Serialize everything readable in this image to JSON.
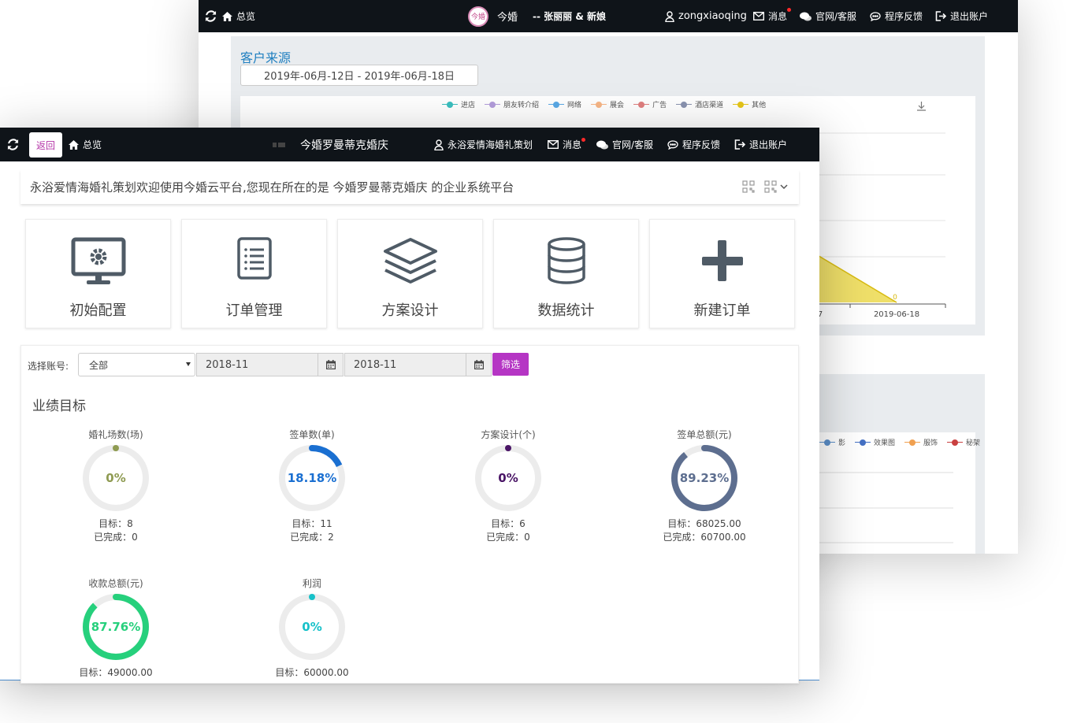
{
  "back_window": {
    "topbar": {
      "overview": "总览",
      "logo_text": "今婚",
      "brand": "今婚",
      "couple": "-- 张丽丽 & 新娘",
      "user": "zongxiaoqing",
      "messages": "消息",
      "site_service": "官网/客服",
      "feedback": "程序反馈",
      "logout": "退出账户"
    },
    "section_title": "客户来源",
    "date_range": "2019年-06月-12日 - 2019年-06月-18日",
    "legend": [
      "进店",
      "朋友转介绍",
      "网络",
      "展会",
      "广告",
      "酒店渠道",
      "其他"
    ],
    "legend_colors": [
      "#3bbfbf",
      "#b39ddb",
      "#5aa9e6",
      "#f7b686",
      "#e07f7f",
      "#8a93b0",
      "#e6c619"
    ],
    "chart_data": {
      "type": "area",
      "x_tick_labels": [
        "7",
        "2019-06-18"
      ],
      "point_label": "0"
    },
    "legend2": [
      "影",
      "效果图",
      "服饰",
      "秘架"
    ],
    "legend2_colors": [
      "#5b8fc9",
      "#4470c4",
      "#f0a050",
      "#c94040"
    ]
  },
  "front_window": {
    "topbar": {
      "back": "返回",
      "overview": "总览",
      "store_name": "今婚罗曼蒂克婚庆",
      "user": "永浴爱情海婚礼策划",
      "messages": "消息",
      "site_service": "官网/客服",
      "feedback": "程序反馈",
      "logout": "退出账户"
    },
    "welcome": "永浴爱情海婚礼策划欢迎使用今婚云平台,您现在所在的是 今婚罗曼蒂克婚庆 的企业系统平台",
    "tiles": [
      {
        "label": "初始配置",
        "icon": "monitor-gear-icon"
      },
      {
        "label": "订单管理",
        "icon": "list-document-icon"
      },
      {
        "label": "方案设计",
        "icon": "layers-icon"
      },
      {
        "label": "数据统计",
        "icon": "database-icon"
      },
      {
        "label": "新建订单",
        "icon": "plus-icon"
      }
    ],
    "filter": {
      "label": "选择账号:",
      "account": "全部",
      "start": "2018-11",
      "end": "2018-11",
      "button": "筛选"
    },
    "perf_title": "业绩目标",
    "gauges": [
      {
        "title": "婚礼场数(场)",
        "percent": "0%",
        "fraction": 0,
        "color": "#8f9b52",
        "target": "目标：8",
        "done": "已完成：0"
      },
      {
        "title": "签单数(单)",
        "percent": "18.18%",
        "fraction": 0.1818,
        "color": "#1a6fd1",
        "target": "目标：11",
        "done": "已完成：2"
      },
      {
        "title": "方案设计(个)",
        "percent": "0%",
        "fraction": 0,
        "color": "#4a1566",
        "target": "目标：6",
        "done": "已完成：0"
      },
      {
        "title": "签单总额(元)",
        "percent": "89.23%",
        "fraction": 0.8923,
        "color": "#5d6e8f",
        "target": "目标：68025.00",
        "done": "已完成：60700.00"
      },
      {
        "title": "收款总额(元)",
        "percent": "87.76%",
        "fraction": 0.8776,
        "color": "#26d07c",
        "target": "目标：49000.00",
        "done": ""
      },
      {
        "title": "利润",
        "percent": "0%",
        "fraction": 0,
        "color": "#17c1c9",
        "target": "目标：60000.00",
        "done": ""
      }
    ]
  }
}
